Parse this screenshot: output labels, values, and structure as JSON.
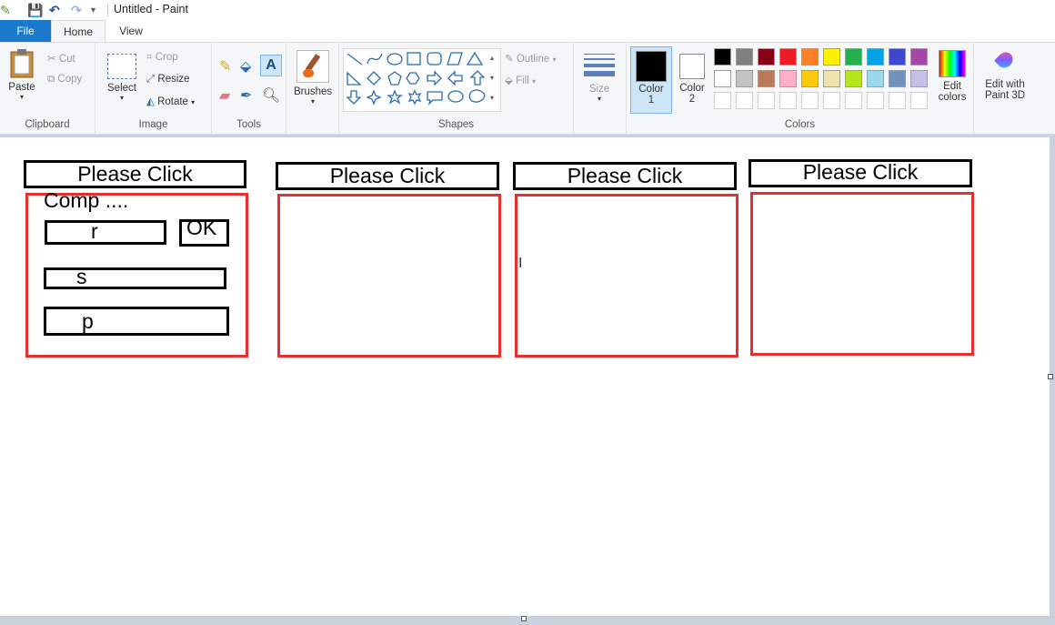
{
  "window": {
    "title": "Untitled - Paint"
  },
  "tabs": [
    "File",
    "Home",
    "View"
  ],
  "ribbon": {
    "clipboard": {
      "paste": "Paste",
      "cut": "Cut",
      "copy": "Copy",
      "label": "Clipboard"
    },
    "image": {
      "select": "Select",
      "crop": "Crop",
      "resize": "Resize",
      "rotate": "Rotate",
      "label": "Image"
    },
    "tools": {
      "label": "Tools"
    },
    "brushes": {
      "label": "Brushes"
    },
    "shapes": {
      "outline": "Outline",
      "fill": "Fill",
      "label": "Shapes"
    },
    "size": {
      "label": "Size"
    },
    "colors": {
      "color1": "Color",
      "color1_num": "1",
      "color2": "Color",
      "color2_num": "2",
      "edit": "Edit",
      "edit2": "colors",
      "label": "Colors",
      "palette": [
        "#000000",
        "#7f7f7f",
        "#880015",
        "#ed1c24",
        "#ff7f27",
        "#fff200",
        "#22b14c",
        "#00a2e8",
        "#3f48cc",
        "#a349a4",
        "#ffffff",
        "#c3c3c3",
        "#b97a57",
        "#ffaec9",
        "#ffc90e",
        "#efe4b0",
        "#b5e61d",
        "#99d9ea",
        "#7092be",
        "#c8bfe7"
      ]
    },
    "paint3d": {
      "line1": "Edit with",
      "line2": "Paint 3D"
    }
  },
  "canvas": {
    "panels": [
      {
        "header": "Please Click"
      },
      {
        "header": "Please Click"
      },
      {
        "header": "Please Click"
      },
      {
        "header": "Please Click"
      }
    ],
    "first_panel": {
      "title": "Comp ....",
      "field_r": "r",
      "ok": "OK",
      "field_s": "s",
      "field_p": "p"
    }
  }
}
